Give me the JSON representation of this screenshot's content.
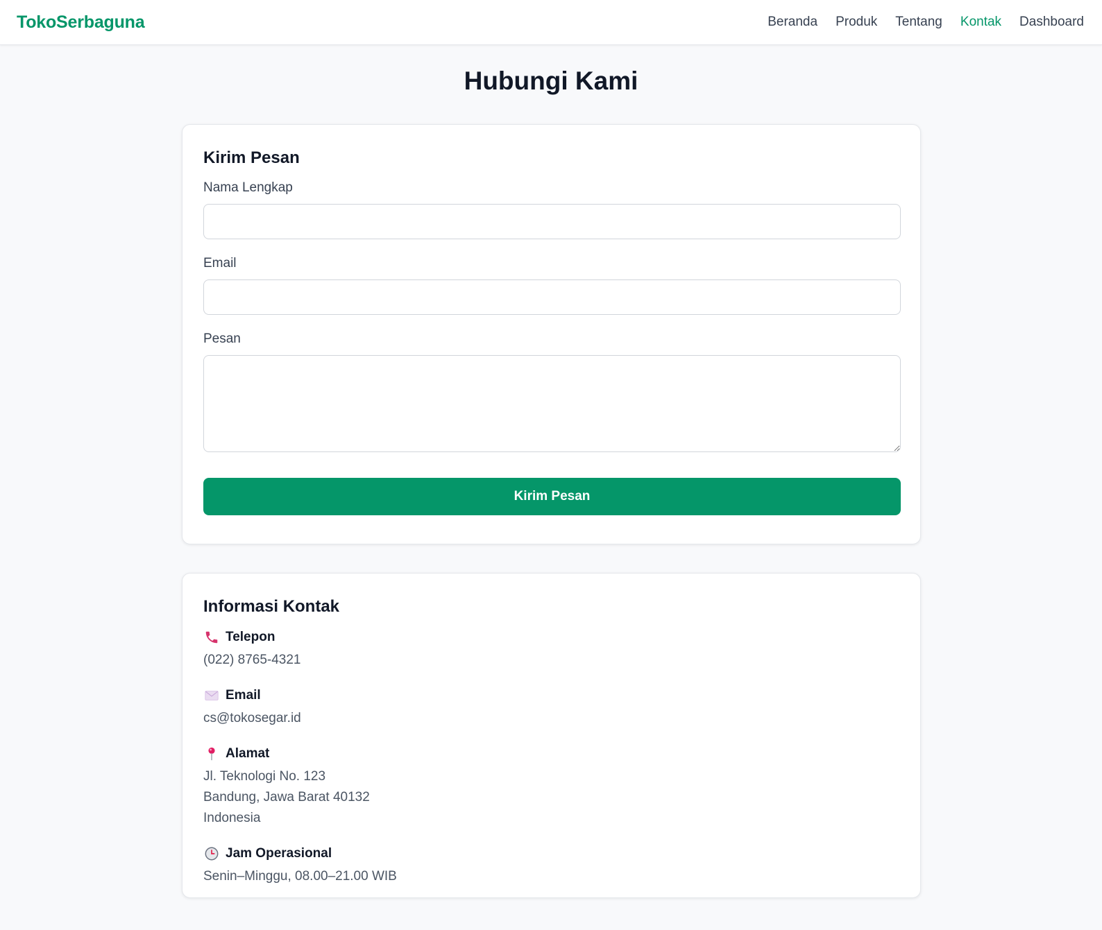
{
  "nav": {
    "brand": "TokoSerbaguna",
    "links": [
      {
        "label": "Beranda"
      },
      {
        "label": "Produk"
      },
      {
        "label": "Tentang"
      },
      {
        "label": "Kontak",
        "active": true
      },
      {
        "label": "Dashboard"
      }
    ]
  },
  "page": {
    "title": "Hubungi Kami"
  },
  "form": {
    "title": "Kirim Pesan",
    "name_label": "Nama Lengkap",
    "name_value": "",
    "email_label": "Email",
    "email_value": "",
    "message_label": "Pesan",
    "message_value": "",
    "submit_label": "Kirim Pesan"
  },
  "contact": {
    "title": "Informasi Kontak",
    "phone": {
      "icon": "phone-icon",
      "label": "Telepon",
      "value": "(022) 8765-4321"
    },
    "email": {
      "icon": "envelope-icon",
      "label": "Email",
      "value": "cs@tokosegar.id"
    },
    "address": {
      "icon": "map-pin-icon",
      "label": "Alamat",
      "lines": [
        "Jl. Teknologi No. 123",
        "Bandung, Jawa Barat 40132",
        "Indonesia"
      ]
    },
    "hours": {
      "icon": "clock-icon",
      "label": "Jam Operasional",
      "value": "Senin–Minggu, 08.00–21.00 WIB"
    }
  },
  "colors": {
    "accent": "#059669",
    "background": "#f8f9fb",
    "heading": "#111827",
    "muted_text": "#4b5563"
  }
}
